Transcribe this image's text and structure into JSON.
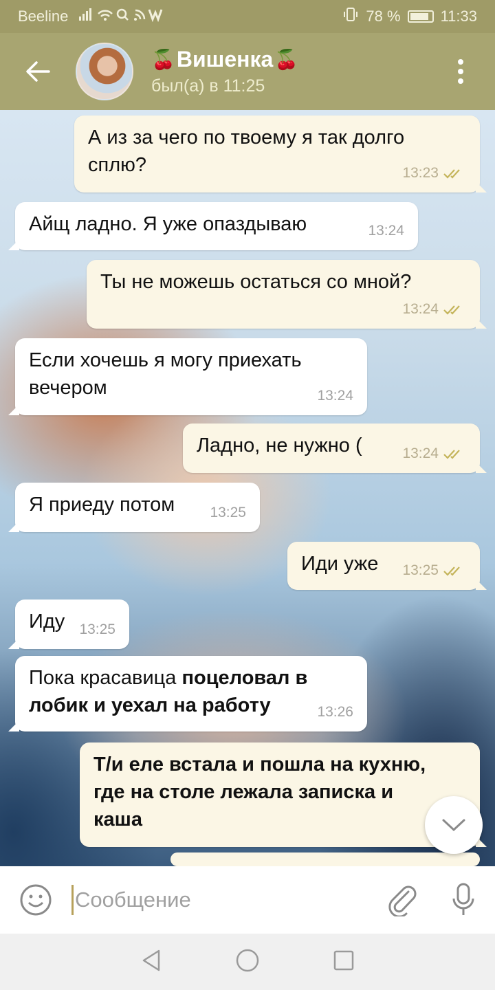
{
  "status_bar": {
    "carrier": "Beeline",
    "signal_icons": "▮▯ᯤ⌕ ⋰ W",
    "vibrate_icon": "vibrate-icon",
    "battery_percent": "78 %",
    "battery_level": 0.78,
    "time": "11:33"
  },
  "header": {
    "back_icon": "arrow-left-icon",
    "cherry_left": "🍒",
    "cherry_right": "🍒",
    "contact_name": "Вишенка",
    "last_seen": "был(а) в 11:25",
    "menu_icon": "more-vert-icon"
  },
  "messages": [
    {
      "dir": "out",
      "lines": [
        "А из за чего по твоему я так долго",
        "сплю?"
      ],
      "time": "13:23",
      "read": true
    },
    {
      "dir": "in",
      "text": "Айщ ладно. Я уже опаздываю",
      "time": "13:24"
    },
    {
      "dir": "out",
      "text": "Ты не можешь остаться со мной?",
      "time": "13:24",
      "read": true
    },
    {
      "dir": "in",
      "lines": [
        "Если хочешь я могу приехать",
        "вечером"
      ],
      "time": "13:24"
    },
    {
      "dir": "out",
      "text": "Ладно, не нужно (",
      "time": "13:24",
      "read": true
    },
    {
      "dir": "in",
      "text": "Я приеду потом",
      "time": "13:25"
    },
    {
      "dir": "out",
      "text": "Иди уже",
      "time": "13:25",
      "read": true
    },
    {
      "dir": "in",
      "text": "Иду",
      "time": "13:25"
    },
    {
      "dir": "in",
      "plain": "Пока красавица ",
      "bold_line1": "поцеловал в",
      "bold_line2": "лобик и уехал на работу",
      "time": "13:26"
    },
    {
      "dir": "out",
      "bold_lines": [
        "Т/и еле встала и пошла на кухню,",
        "где на столе лежала записка и",
        "каша"
      ],
      "time": "13:"
    }
  ],
  "scroll_down_icon": "chevron-down-icon",
  "input": {
    "emoji_icon": "emoji-icon",
    "placeholder": "Сообщение",
    "attach_icon": "paperclip-icon",
    "mic_icon": "microphone-icon"
  },
  "nav": {
    "back_icon": "nav-back-icon",
    "home_icon": "nav-home-icon",
    "recents_icon": "nav-recents-icon"
  },
  "colors": {
    "header": "#a8a571",
    "status_bar": "#9f9b67",
    "outgoing_bubble": "#fbf6e5",
    "incoming_bubble": "#ffffff",
    "read_ticks": "#c4b45a"
  }
}
